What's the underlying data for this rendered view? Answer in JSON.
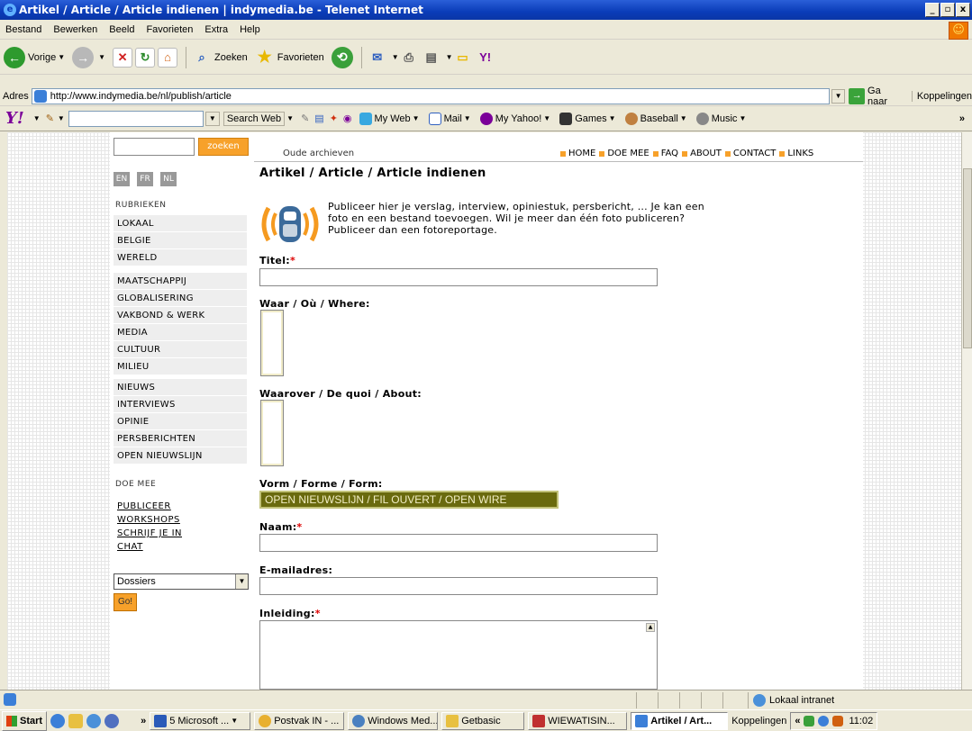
{
  "window": {
    "title": "Artikel / Article / Article indienen | indymedia.be - Telenet Internet"
  },
  "menu": [
    "Bestand",
    "Bewerken",
    "Beeld",
    "Favorieten",
    "Extra",
    "Help"
  ],
  "toolbar": {
    "back": "Vorige",
    "search": "Zoeken",
    "favorites": "Favorieten"
  },
  "address": {
    "label": "Adres",
    "url": "http://www.indymedia.be/nl/publish/article",
    "go": "Ga naar",
    "links": "Koppelingen"
  },
  "yahoo": {
    "search_web": "Search Web",
    "links": [
      "My Web",
      "Mail",
      "My Yahoo!",
      "Games",
      "Baseball",
      "Music"
    ]
  },
  "sidebar": {
    "search_button": "zoeken",
    "languages": [
      "EN",
      "FR",
      "NL"
    ],
    "rubrieken_heading": "RUBRIEKEN",
    "group1": [
      "LOKAAL",
      "BELGIE",
      "WERELD"
    ],
    "group2": [
      "MAATSCHAPPIJ",
      "GLOBALISERING",
      "VAKBOND & WERK",
      "MEDIA",
      "CULTUUR",
      "MILIEU"
    ],
    "group3": [
      "NIEUWS",
      "INTERVIEWS",
      "OPINIE",
      "PERSBERICHTEN",
      "OPEN NIEUWSLIJN"
    ],
    "doe_mee_heading": "DOE MEE",
    "doe_mee_links": [
      "PUBLICEER",
      "WORKSHOPS",
      "SCHRIJF JE IN",
      "CHAT"
    ],
    "dossiers_select": "Dossiers",
    "go_button": "Go!"
  },
  "topnav": {
    "archive": "Oude archieven",
    "links": [
      "HOME",
      "DOE MEE",
      "FAQ",
      "ABOUT",
      "CONTACT",
      "LINKS"
    ]
  },
  "form": {
    "page_title": "Artikel / Article / Article indienen",
    "intro": "Publiceer hier je verslag, interview, opiniestuk, persbericht, ... Je kan een foto en een bestand toevoegen. Wil je meer dan één foto publiceren? Publiceer dan een fotoreportage.",
    "titel_label": "Titel:",
    "waar_label": "Waar / Où / Where:",
    "waarover_label": "Waarover / De quoi / About:",
    "vorm_label": "Vorm / Forme / Form:",
    "vorm_value": "OPEN NIEUWSLIJN / FIL OUVERT / OPEN WIRE",
    "naam_label": "Naam:",
    "email_label": "E-mailadres:",
    "inleiding_label": "Inleiding:",
    "required_mark": "*"
  },
  "statusbar": {
    "zone": "Lokaal intranet"
  },
  "taskbar": {
    "start": "Start",
    "tasks": [
      "5 Microsoft ...",
      "Postvak IN - ...",
      "Windows Med...",
      "Getbasic",
      "WIEWATISIN...",
      "Artikel / Art..."
    ],
    "links": "Koppelingen",
    "clock": "11:02"
  },
  "colors": {
    "accent_orange": "#f7a12a",
    "titlebar_blue": "#0a3cb8",
    "required_red": "#dd0000"
  }
}
